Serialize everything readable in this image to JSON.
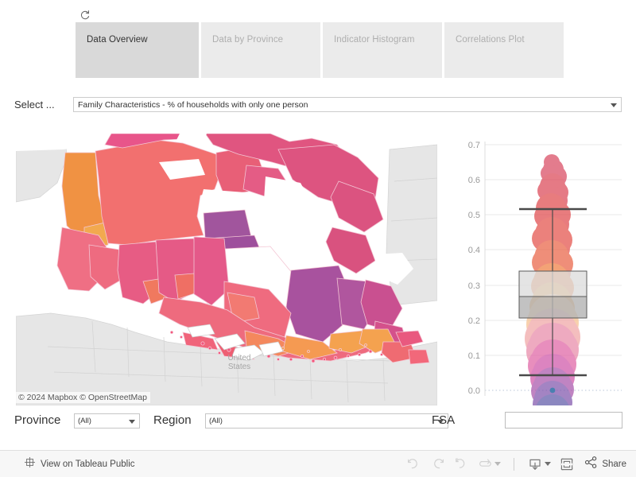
{
  "toolbar_top": {
    "reset_icon": "refresh-reset-icon"
  },
  "tabs": [
    {
      "label": "Data Overview",
      "active": true
    },
    {
      "label": "Data by Province",
      "active": false
    },
    {
      "label": "Indicator Histogram",
      "active": false
    },
    {
      "label": "Correlations Plot",
      "active": false
    }
  ],
  "parameter": {
    "label": "Select ...",
    "value": "Family Characteristics - % of households with only one person",
    "caret_icon": "chevron-down-icon"
  },
  "map": {
    "attribution": "© 2024 Mapbox  © OpenStreetMap",
    "country_label": "United States",
    "base_color": "#ededed",
    "land_color": "#e3e3e3",
    "border_color": "#cfcfcf",
    "water_color": "#ffffff"
  },
  "filters": {
    "province": {
      "label": "Province",
      "value": "(All)"
    },
    "region": {
      "label": "Region",
      "value": "(All)"
    },
    "fsa": {
      "label": "FSA",
      "value": "",
      "placeholder": ""
    }
  },
  "bottom_toolbar": {
    "tableau_label": "View on Tableau Public",
    "tableau_icon": "tableau-logo-icon",
    "undo_icon": "undo-icon",
    "redo_icon": "redo-icon",
    "revert_icon": "revert-icon",
    "refresh_icon": "refresh-icon",
    "refresh_caret_icon": "chevron-down-icon",
    "download_icon": "download-icon",
    "download_caret_icon": "chevron-down-icon",
    "fullscreen_icon": "fullscreen-icon",
    "share_icon": "share-icon",
    "share_label": "Share"
  },
  "chart_data": {
    "type": "box",
    "title": "",
    "xlabel": "",
    "ylabel": "",
    "ylim": [
      0.0,
      0.7
    ],
    "yticks": [
      "0.0",
      "0.1",
      "0.2",
      "0.3",
      "0.4",
      "0.5",
      "0.6",
      "0.7"
    ],
    "ytick_values": [
      0.0,
      0.1,
      0.2,
      0.3,
      0.4,
      0.5,
      0.6,
      0.7
    ],
    "grid": true,
    "legend": "none",
    "boxes": [
      {
        "name": "% of households with only one person",
        "whisker_low": 0.044,
        "q1": 0.214,
        "median": 0.267,
        "q3": 0.34,
        "whisker_high": 0.516,
        "min_point": 0.0,
        "max_point": 0.672
      }
    ],
    "points_note": "dense overlapping circle marks colored by value (viridis/plasma-like: dark blue low → magenta → orange → red high)",
    "point_color_low": "#5a5b9f",
    "point_color_mid": "#d6569b",
    "point_color_high": "#e8465a",
    "point_color_highest": "#f0a03c"
  }
}
